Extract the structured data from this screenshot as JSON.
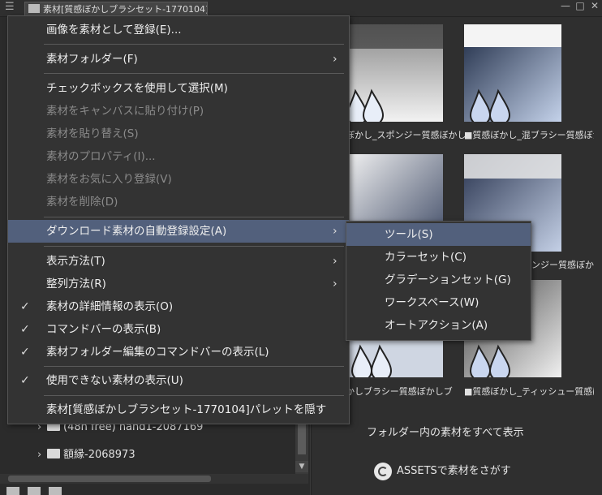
{
  "tab": {
    "title": "素材[質感ぼかしブラシセット-1770104]"
  },
  "window_controls": [
    "—",
    "□",
    "✕"
  ],
  "context_menu": {
    "items": [
      {
        "label": "画像を素材として登録(E)...",
        "disabled": false,
        "checked": false,
        "submenu": false,
        "highlighted": false
      },
      {
        "label": "素材フォルダー(F)",
        "disabled": false,
        "checked": false,
        "submenu": true,
        "highlighted": false
      },
      {
        "label": "チェックボックスを使用して選択(M)",
        "disabled": false,
        "checked": false,
        "submenu": false,
        "highlighted": false
      },
      {
        "label": "素材をキャンバスに貼り付け(P)",
        "disabled": true,
        "checked": false,
        "submenu": false,
        "highlighted": false
      },
      {
        "label": "素材を貼り替え(S)",
        "disabled": true,
        "checked": false,
        "submenu": false,
        "highlighted": false
      },
      {
        "label": "素材のプロパティ(I)...",
        "disabled": true,
        "checked": false,
        "submenu": false,
        "highlighted": false
      },
      {
        "label": "素材をお気に入り登録(V)",
        "disabled": true,
        "checked": false,
        "submenu": false,
        "highlighted": false
      },
      {
        "label": "素材を削除(D)",
        "disabled": true,
        "checked": false,
        "submenu": false,
        "highlighted": false
      },
      {
        "label": "ダウンロード素材の自動登録設定(A)",
        "disabled": false,
        "checked": false,
        "submenu": true,
        "highlighted": true
      },
      {
        "label": "表示方法(T)",
        "disabled": false,
        "checked": false,
        "submenu": true,
        "highlighted": false
      },
      {
        "label": "整列方法(R)",
        "disabled": false,
        "checked": false,
        "submenu": true,
        "highlighted": false
      },
      {
        "label": "素材の詳細情報の表示(O)",
        "disabled": false,
        "checked": true,
        "submenu": false,
        "highlighted": false
      },
      {
        "label": "コマンドバーの表示(B)",
        "disabled": false,
        "checked": true,
        "submenu": false,
        "highlighted": false
      },
      {
        "label": "素材フォルダー編集のコマンドバーの表示(L)",
        "disabled": false,
        "checked": true,
        "submenu": false,
        "highlighted": false
      },
      {
        "label": "使用できない素材の表示(U)",
        "disabled": false,
        "checked": true,
        "submenu": false,
        "highlighted": false
      },
      {
        "label": "素材[質感ぼかしブラシセット-1770104]パレットを隠す",
        "disabled": false,
        "checked": false,
        "submenu": false,
        "highlighted": false
      }
    ],
    "check_glyph": "✓",
    "arrow_glyph": "›"
  },
  "submenu": {
    "items": [
      {
        "label": "ツール(S)",
        "highlighted": true
      },
      {
        "label": "カラーセット(C)",
        "highlighted": false
      },
      {
        "label": "グラデーションセット(G)",
        "highlighted": false
      },
      {
        "label": "ワークスペース(W)",
        "highlighted": false
      },
      {
        "label": "オートアクション(A)",
        "highlighted": false
      }
    ]
  },
  "tree": {
    "items": [
      {
        "label": "(48h free) hand1-2087169"
      },
      {
        "label": "額縁-2068973"
      }
    ],
    "chevron": "›"
  },
  "materials": {
    "captions": [
      "ぼかし_スポンジー質感ぼかし",
      "■質感ぼかし_混ブラシー質感ぼかし",
      "ンジー質感ぼか",
      "かしブラシー質感ぼかしブ",
      "■質感ぼかし_ティッシュー質感ぼかし"
    ]
  },
  "footer": {
    "show_all": "フォルダー内の素材をすべて表示",
    "assets_button": "ASSETSで素材をさがす"
  },
  "colors": {
    "menu_bg": "#333333",
    "highlight": "#52607c",
    "disabled_text": "#8a8a8a"
  }
}
